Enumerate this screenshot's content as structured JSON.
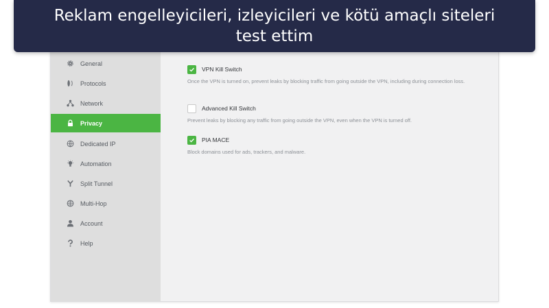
{
  "banner": {
    "line1": "Reklam engelleyicileri, izleyicileri ve kötü amaçlı siteleri",
    "line2": "test ettim"
  },
  "sidebar": {
    "items": [
      {
        "label": "General",
        "icon": "gear-icon"
      },
      {
        "label": "Protocols",
        "icon": "protocols-icon"
      },
      {
        "label": "Network",
        "icon": "network-icon"
      },
      {
        "label": "Privacy",
        "icon": "lock-icon",
        "active": true
      },
      {
        "label": "Dedicated IP",
        "icon": "dedicated-ip-icon"
      },
      {
        "label": "Automation",
        "icon": "bulb-icon"
      },
      {
        "label": "Split Tunnel",
        "icon": "split-icon"
      },
      {
        "label": "Multi-Hop",
        "icon": "globe-icon"
      },
      {
        "label": "Account",
        "icon": "person-icon"
      },
      {
        "label": "Help",
        "icon": "question-icon"
      }
    ]
  },
  "privacy": {
    "options": [
      {
        "title": "VPN Kill Switch",
        "checked": true,
        "description": "Once the VPN is turned on, prevent leaks by blocking traffic from going outside the VPN, including during connection loss."
      },
      {
        "title": "Advanced Kill Switch",
        "checked": false,
        "description": "Prevent leaks by blocking any traffic from going outside the VPN, even when the VPN is turned off."
      },
      {
        "title": "PIA MACE",
        "checked": true,
        "description": "Block domains used for ads, trackers, and malware."
      }
    ]
  },
  "colors": {
    "accent": "#4bb543",
    "banner_bg": "#252a48",
    "sidebar_bg": "#dedede",
    "content_bg": "#f1f1f2"
  }
}
